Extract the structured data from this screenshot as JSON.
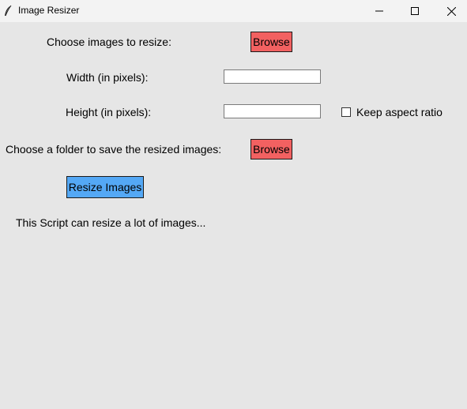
{
  "window": {
    "title": "Image Resizer",
    "icons": {
      "app": "feather-icon",
      "minimize": "minimize-icon",
      "maximize": "maximize-icon",
      "close": "close-icon"
    }
  },
  "form": {
    "choose_images_label": "Choose images to resize:",
    "browse_images_label": "Browse",
    "width_label": "Width (in pixels):",
    "width_value": "",
    "height_label": "Height (in pixels):",
    "height_value": "",
    "keep_aspect_label": "Keep aspect ratio",
    "keep_aspect_checked": false,
    "choose_folder_label": "Choose a folder to save the resized images:",
    "browse_folder_label": "Browse",
    "resize_button_label": "Resize Images",
    "status_text": "This Script can resize a lot of images..."
  },
  "colors": {
    "background": "#e6e6e6",
    "browse_button": "#f26161",
    "resize_button": "#54a8f5"
  }
}
